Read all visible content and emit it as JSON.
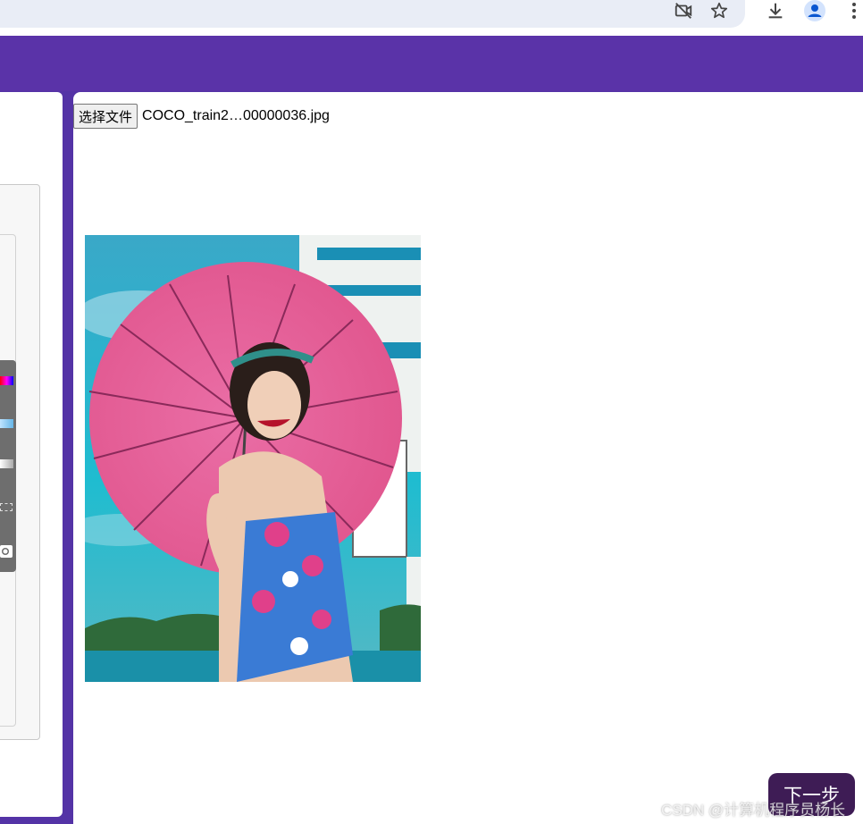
{
  "browser": {
    "icons": [
      "camera-off-icon",
      "bookmark-star-icon",
      "download-icon",
      "profile-avatar-icon",
      "more-menu-icon"
    ],
    "accent_color": "#0b57d0"
  },
  "app": {
    "header_color": "#5a33a8",
    "background_color": "#5433a6"
  },
  "upload": {
    "button_label": "选择文件",
    "file_name": "COCO_train2…00000036.jpg"
  },
  "preview": {
    "alt": "Woman in floral swimsuit holding pink parasol"
  },
  "actions": {
    "next_label": "下一步"
  },
  "watermark": {
    "text": "CSDN @计算机程序员杨长"
  }
}
